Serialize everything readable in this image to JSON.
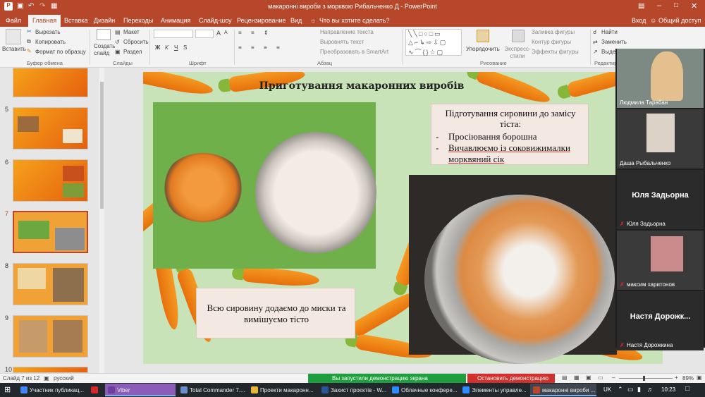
{
  "window": {
    "title": "макаронні вироби з морквою Рибальченко Д - PowerPoint",
    "signin": "Вход",
    "share": "Общий доступ",
    "search_hint": "Что вы хотите сделать?"
  },
  "tabs": [
    "Файл",
    "Главная",
    "Вставка",
    "Дизайн",
    "Переходы",
    "Анимация",
    "Слайд-шоу",
    "Рецензирование",
    "Вид"
  ],
  "ribbon": {
    "paste": "Вставить",
    "cut": "Вырезать",
    "copy": "Копировать",
    "format_painter": "Формат по образцу",
    "clipboard": "Буфер обмена",
    "new_slide": "Создать слайд",
    "layout": "Макет",
    "reset": "Сбросить",
    "section": "Раздел",
    "slides": "Слайды",
    "font": "Шрифт",
    "font_size_up": "A",
    "font_size_down": "A",
    "text_direction": "Направление текста",
    "align_text": "Выровнять текст",
    "smartart": "Преобразовать в SmartArt",
    "paragraph": "Абзац",
    "arrange": "Упорядочить",
    "quick_styles": "Экспресс-стили",
    "shape_fill": "Заливка фигуры",
    "shape_outline": "Контур фигуры",
    "shape_effects": "Эффекты фигуры",
    "drawing": "Рисование",
    "find": "Найти",
    "replace": "Заменить",
    "select": "Выде",
    "editing": "Редактир",
    "format_bold": "Ж",
    "format_italic": "К",
    "format_underline": "Ч",
    "format_strike": "S"
  },
  "thumbnails": [
    {
      "num": "5"
    },
    {
      "num": "6"
    },
    {
      "num": "7"
    },
    {
      "num": "8"
    },
    {
      "num": "9"
    },
    {
      "num": "10"
    }
  ],
  "slide": {
    "title": "Приготування макаронних виробів",
    "prep_heading": "Підготування сировини до замісу тіста:",
    "bullet1": "Просіювання борошна",
    "bullet2": "Вичавлюємо із соковижималки морквяний сік",
    "caption": "Всю сировину додаємо до миски та вимішуємо тісто"
  },
  "participants": [
    {
      "name": "Людмила Тарабан",
      "type": "video"
    },
    {
      "name": "Даша Рыбальченко",
      "type": "video"
    },
    {
      "name": "Юля Задьорна",
      "big": "Юля Задьорна",
      "type": "name"
    },
    {
      "name": "максим харитонов",
      "type": "video"
    },
    {
      "name": "Настя Дорожкина",
      "big": "Настя Дорожк...",
      "type": "name"
    }
  ],
  "demo": {
    "running": "Вы запустили демонстрацию экрана",
    "stop": "Остановить демонстрацию"
  },
  "status": {
    "slide_info": "Слайд 7 из 12",
    "language": "русский",
    "zoom": "89%"
  },
  "taskbar": {
    "items": [
      "Участник публикац...",
      "Viber",
      "Total Commander 7....",
      "Проекти макаронн...",
      "Захист проєктів - W...",
      "Облачные конфере...",
      "Элементы управле...",
      "макаронні вироби ..."
    ],
    "lang": "UK",
    "time": "10:23"
  },
  "colors": {
    "accent": "#b7472a",
    "slide_bg": "#f0a236",
    "demo_green": "#1e9e3e",
    "demo_red": "#d0312d"
  }
}
